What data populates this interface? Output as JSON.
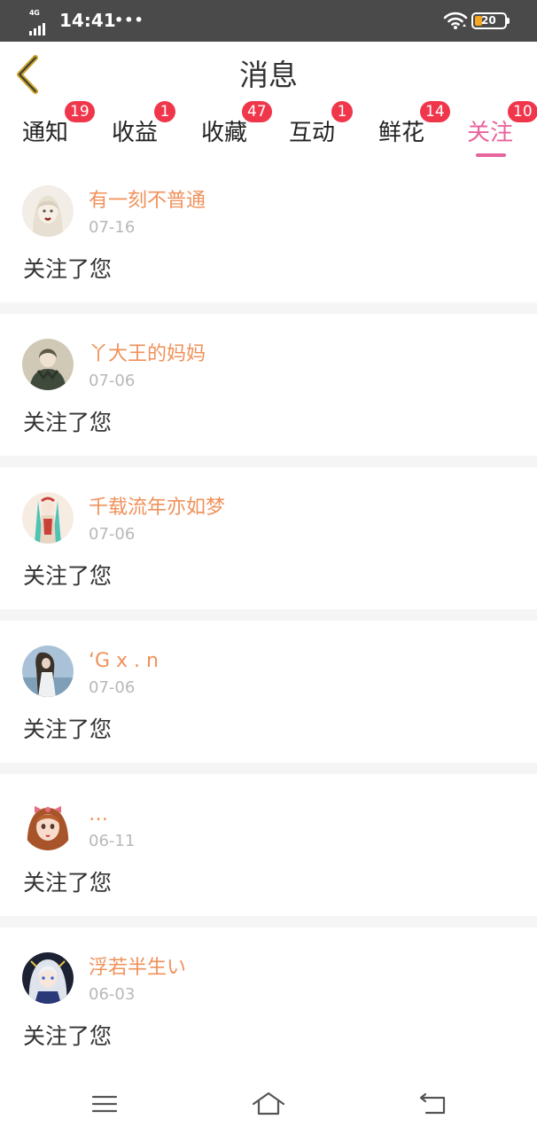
{
  "status_bar": {
    "network": "4G",
    "time": "14:41",
    "dots": "•••",
    "battery": "20"
  },
  "header": {
    "title": "消息",
    "back_icon": "chevron-left-icon"
  },
  "tabs": [
    {
      "label": "通知",
      "badge": "19"
    },
    {
      "label": "收益",
      "badge": "1"
    },
    {
      "label": "收藏",
      "badge": "47"
    },
    {
      "label": "互动",
      "badge": "1"
    },
    {
      "label": "鲜花",
      "badge": "14"
    },
    {
      "label": "关注",
      "badge": "10",
      "active": true
    }
  ],
  "notifications": [
    {
      "name": "有一刻不普通",
      "date": "07-16",
      "text": "关注了您"
    },
    {
      "name": "丫大王的妈妈",
      "date": "07-06",
      "text": "关注了您"
    },
    {
      "name": "千载流年亦如梦",
      "date": "07-06",
      "text": "关注了您"
    },
    {
      "name": "‘G x . n",
      "date": "07-06",
      "text": "关注了您"
    },
    {
      "name": "…",
      "date": "06-11",
      "text": "关注了您"
    },
    {
      "name": "浮若半生い",
      "date": "06-03",
      "text": "关注了您"
    }
  ],
  "nav_bar": {
    "menu_icon": "menu-icon",
    "home_icon": "home-icon",
    "back_icon": "back-arrow-icon"
  },
  "colors": {
    "accent": "#e8649c",
    "username": "#f0915a",
    "badge": "#f0364b",
    "back_chevron": "#c9a227"
  }
}
